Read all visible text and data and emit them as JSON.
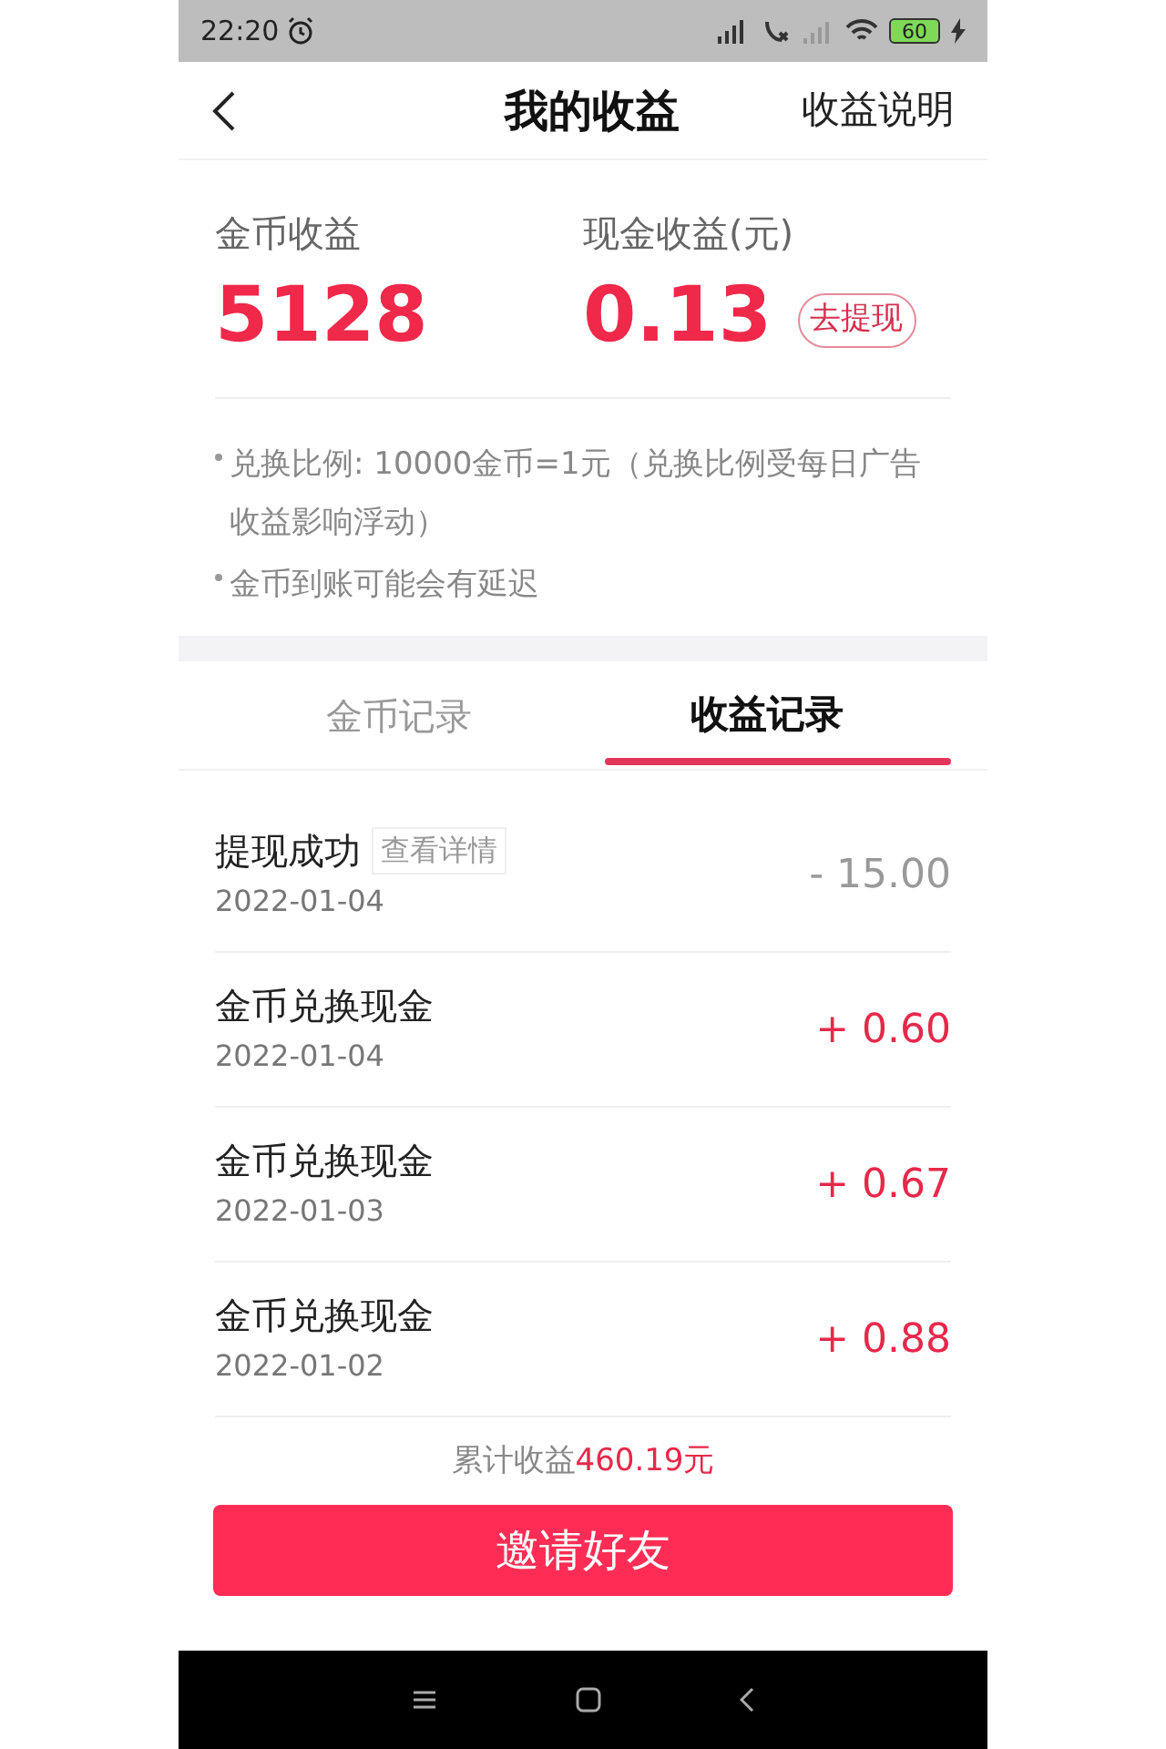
{
  "status_bar": {
    "time": "22:20",
    "battery": "60"
  },
  "header": {
    "title": "我的收益",
    "action": "收益说明"
  },
  "stats": [
    {
      "label": "金币收益",
      "value": "5128"
    },
    {
      "label": "现金收益(元)",
      "value": "0.13",
      "button": "去提现"
    }
  ],
  "notes": [
    "兑换比例: 10000金币=1元（兑换比例受每日广告收益影响浮动）",
    "金币到账可能会有延迟"
  ],
  "tabs": [
    {
      "label": "金币记录",
      "selected": false
    },
    {
      "label": "收益记录",
      "selected": true
    }
  ],
  "records": [
    {
      "kind": "withdrawal",
      "title": "提现成功",
      "detail_button": "查看详情",
      "date": "2022-01-04",
      "amount": "- 15.00"
    },
    {
      "kind": "exchange",
      "title": "金币兑换现金",
      "date": "2022-01-04",
      "amount": "+ 0.60"
    },
    {
      "kind": "exchange",
      "title": "金币兑换现金",
      "date": "2022-01-03",
      "amount": "+ 0.67"
    },
    {
      "kind": "exchange",
      "title": "金币兑换现金",
      "date": "2022-01-02",
      "amount": "+ 0.88"
    }
  ],
  "footer": {
    "total_label": "累计收益",
    "total_value": "460.19元",
    "button": "邀请好友"
  }
}
